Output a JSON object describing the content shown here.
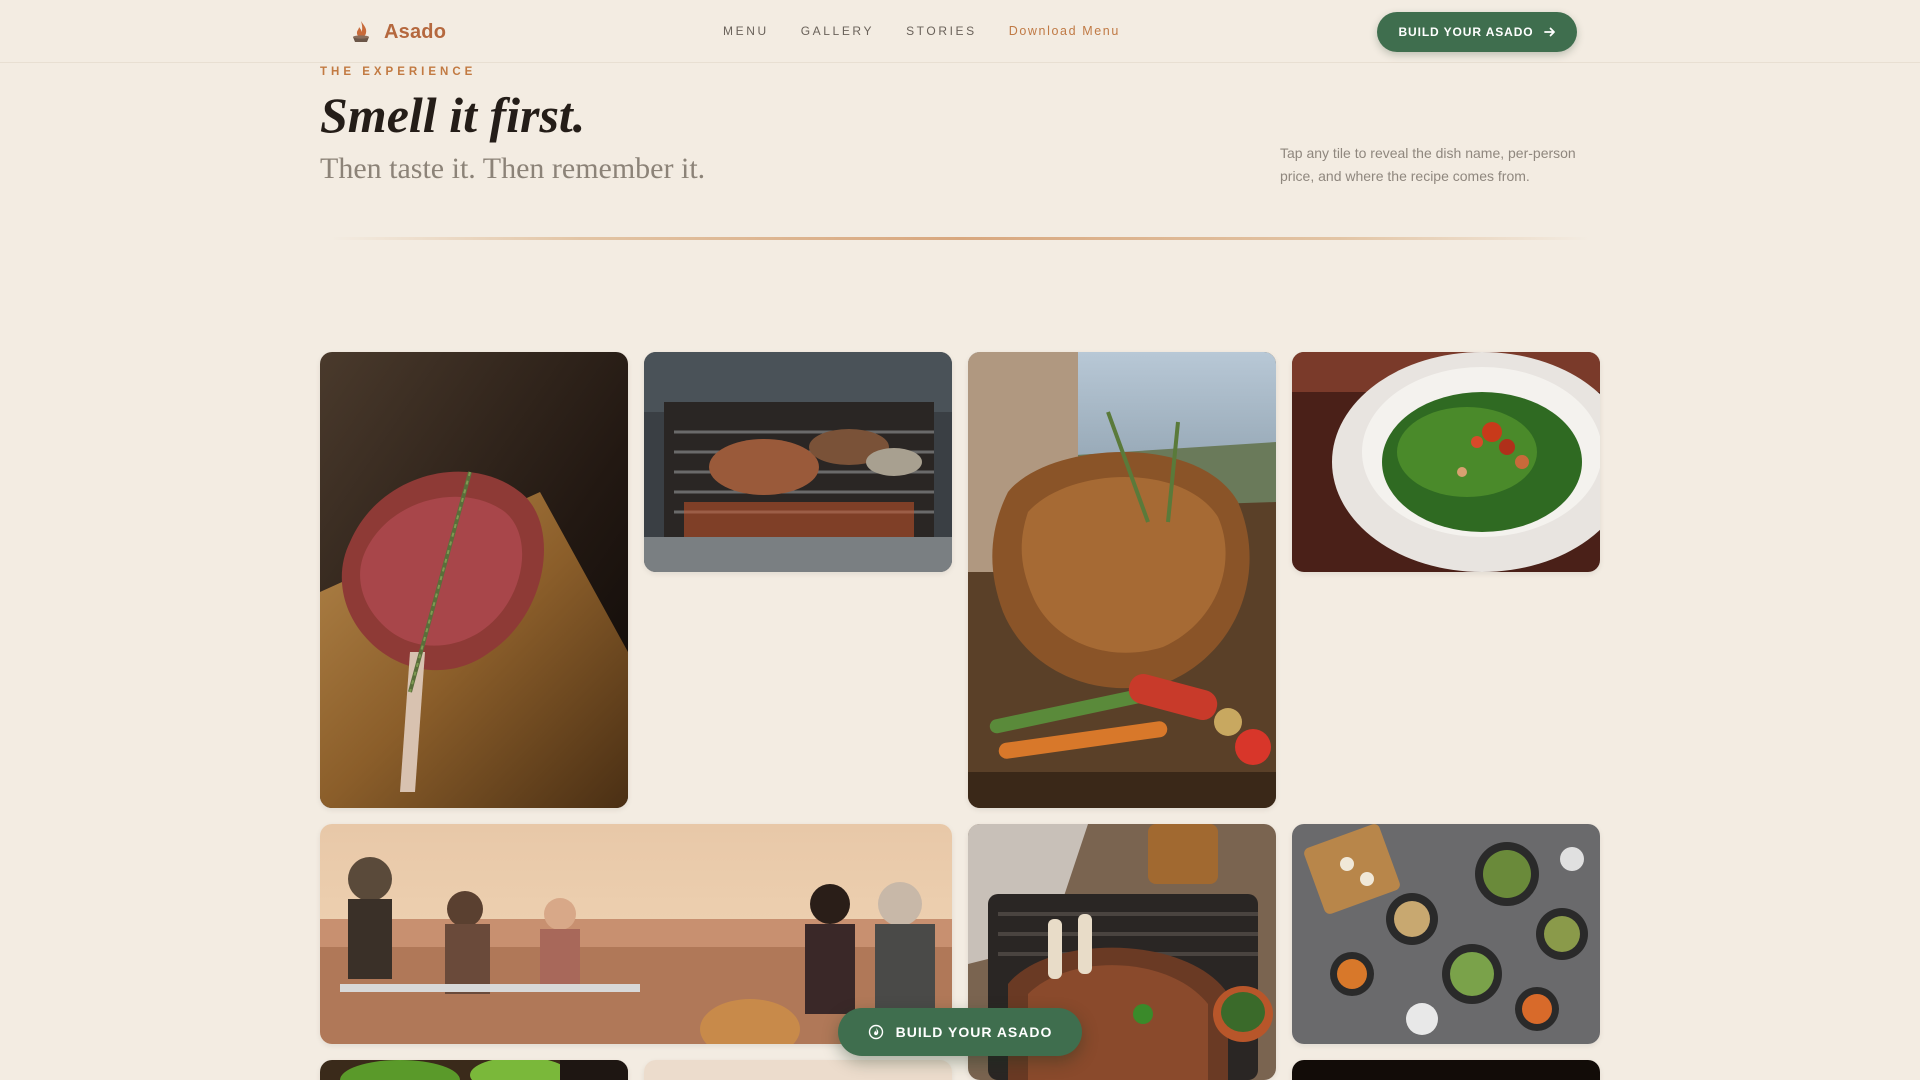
{
  "header": {
    "brand": "Asado",
    "nav": [
      "MENU",
      "GALLERY",
      "STORIES"
    ],
    "download_link": "Download Menu",
    "cta_label": "BUILD YOUR ASADO"
  },
  "hero": {
    "eyebrow": "THE EXPERIENCE",
    "title": "Smell it first.",
    "subtitle": "Then taste it. Then remember it.",
    "hint": "Tap any tile to reveal the dish name, per-person price, and where the recipe comes from."
  },
  "floating_cta": {
    "label": "BUILD YOUR ASADO"
  },
  "icons": {
    "brand": "flame-icon",
    "header_cta": "arrow-right-icon",
    "floating_cta": "flame-badge-icon"
  },
  "colors": {
    "background": "#f3ece2",
    "brand": "#b5683e",
    "accent": "#c27a42",
    "cta": "#3f6e4e"
  }
}
